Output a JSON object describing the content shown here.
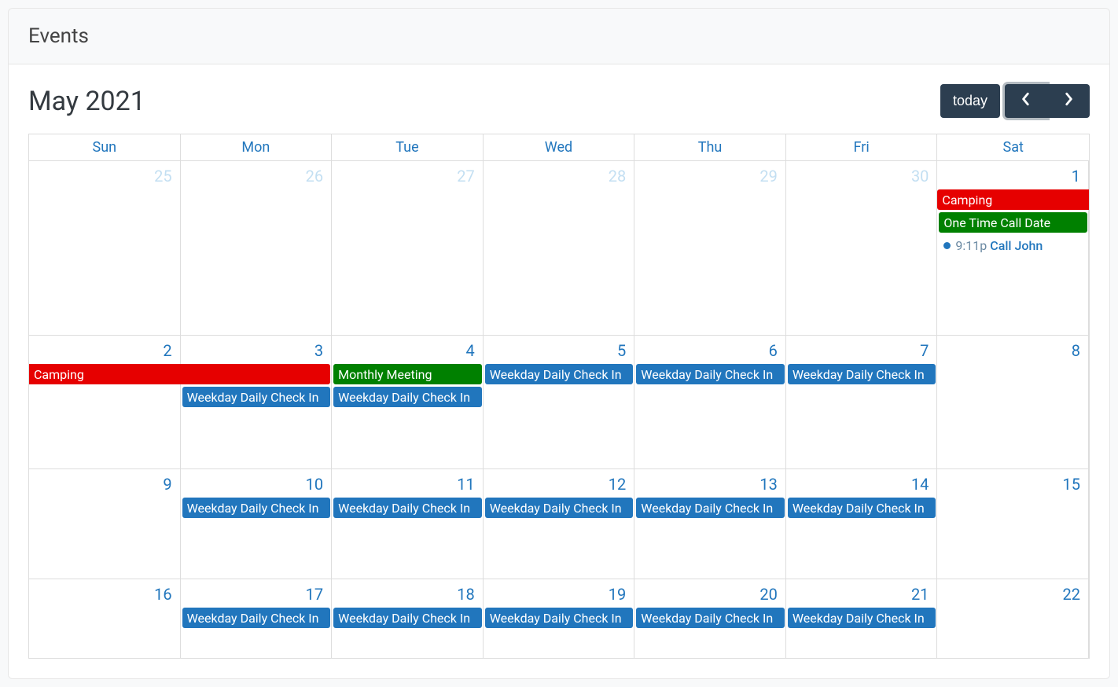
{
  "header": {
    "title": "Events"
  },
  "calendar": {
    "month_title": "May 2021",
    "today_label": "today",
    "daynames": [
      "Sun",
      "Mon",
      "Tue",
      "Wed",
      "Thu",
      "Fri",
      "Sat"
    ],
    "weeks": [
      {
        "days": [
          "25",
          "26",
          "27",
          "28",
          "29",
          "30",
          "1"
        ],
        "other": [
          true,
          true,
          true,
          true,
          true,
          true,
          false
        ]
      },
      {
        "days": [
          "2",
          "3",
          "4",
          "5",
          "6",
          "7",
          "8"
        ],
        "other": [
          false,
          false,
          false,
          false,
          false,
          false,
          false
        ]
      },
      {
        "days": [
          "9",
          "10",
          "11",
          "12",
          "13",
          "14",
          "15"
        ],
        "other": [
          false,
          false,
          false,
          false,
          false,
          false,
          false
        ]
      },
      {
        "days": [
          "16",
          "17",
          "18",
          "19",
          "20",
          "21",
          "22"
        ],
        "other": [
          false,
          false,
          false,
          false,
          false,
          false,
          false
        ]
      }
    ],
    "events": {
      "camping": "Camping",
      "one_time_call": "One Time Call Date",
      "call_john_time": "9:11p",
      "call_john": "Call John",
      "monthly_meeting": "Monthly Meeting",
      "weekday_checkin": "Weekday Daily Check In"
    }
  }
}
